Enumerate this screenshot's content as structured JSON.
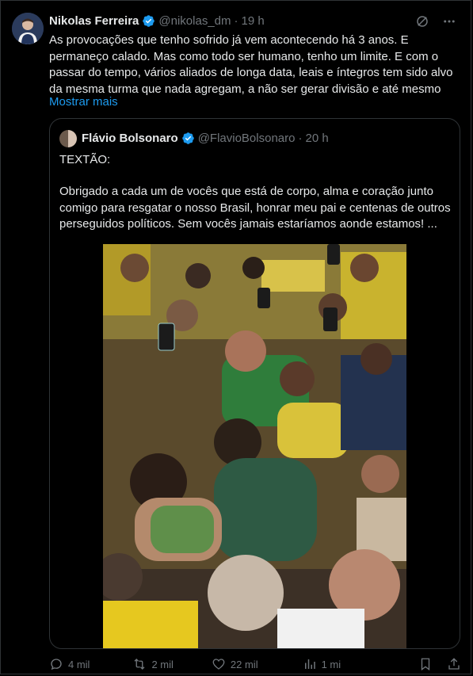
{
  "post": {
    "author_name": "Nikolas Ferreira",
    "handle": "@nikolas_dm",
    "separator": "·",
    "time": "19 h",
    "text": "As provocações que tenho sofrido já vem acontecendo há 3 anos. E permaneço calado. Mas como todo ser humano, tenho um limite. E com o passar do tempo, vários aliados de longa data, leais e íntegros tem sido alvo da mesma turma que nada agregam, a não ser gerar divisão e até mesmo",
    "show_more": "Mostrar mais"
  },
  "quote": {
    "author_name": "Flávio Bolsonaro",
    "handle": "@FlavioBolsonaro",
    "separator": "·",
    "time": "20 h",
    "title": "TEXTÃO:",
    "text": "Obrigado a cada um de vocês que está de corpo, alma e coração junto comigo para resgatar o nosso Brasil, honrar meu pai e centenas de outros perseguidos políticos. Sem vocês jamais estaríamos aonde estamos! ..."
  },
  "actions": {
    "replies": "4 mil",
    "reposts": "2 mil",
    "likes": "22 mil",
    "views": "1 mi"
  },
  "icons": {
    "verified": "verified-badge-icon",
    "grok": "grok-icon",
    "more": "more-icon"
  },
  "colors": {
    "accent": "#1d9bf0",
    "muted": "#71767b",
    "text": "#e7e9ea",
    "border": "#2f3336",
    "background": "#000000"
  }
}
